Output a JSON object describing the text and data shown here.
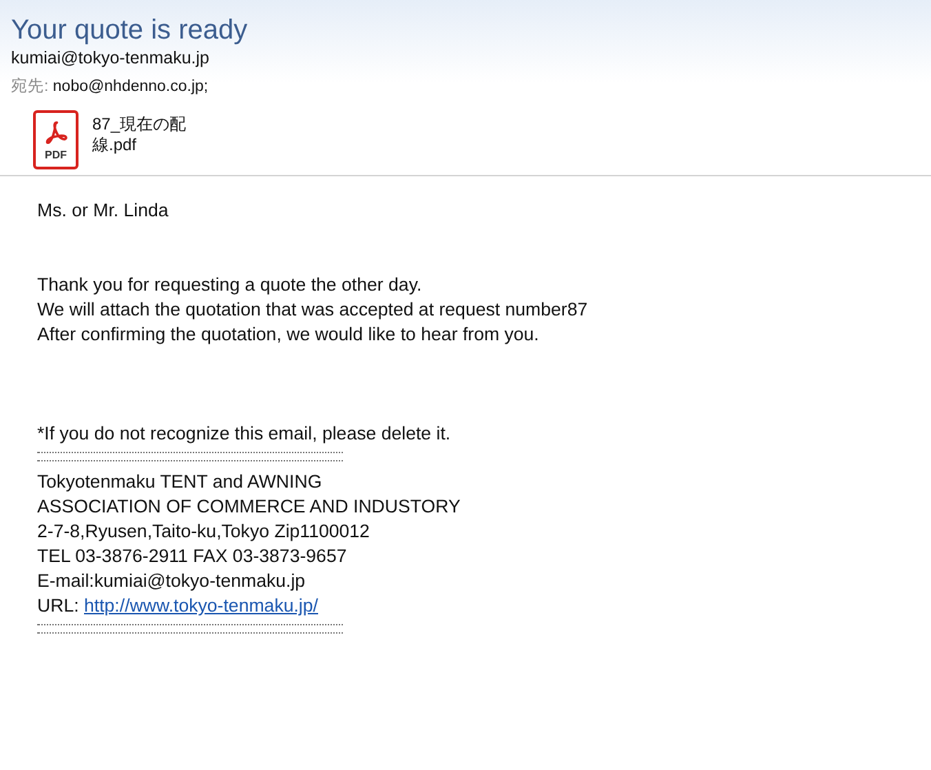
{
  "header": {
    "subject": "Your quote is ready",
    "sender": "kumiai@tokyo-tenmaku.jp",
    "to_label": "宛先:",
    "to": "nobo@nhdenno.co.jp;"
  },
  "attachment": {
    "kind": "pdf",
    "icon_label": "PDF",
    "name_lines": [
      "87_現在の配",
      "線.pdf"
    ]
  },
  "body": {
    "greeting": "Ms. or Mr. Linda",
    "message": [
      "Thank you for requesting a quote the other day.",
      "We will attach the quotation that was accepted at request number87",
      "After confirming the quotation, we would like to hear from you."
    ],
    "notice": "*If you do not recognize this email, please delete it.",
    "signature": [
      "Tokyotenmaku TENT and AWNING",
      "ASSOCIATION OF COMMERCE AND INDUSTORY",
      "2-7-8,Ryusen,Taito-ku,Tokyo Zip1100012",
      "TEL 03-3876-2911 FAX 03-3873-9657",
      "E-mail:kumiai@tokyo-tenmaku.jp"
    ],
    "url_label": "URL:",
    "url": "http://www.tokyo-tenmaku.jp/"
  }
}
